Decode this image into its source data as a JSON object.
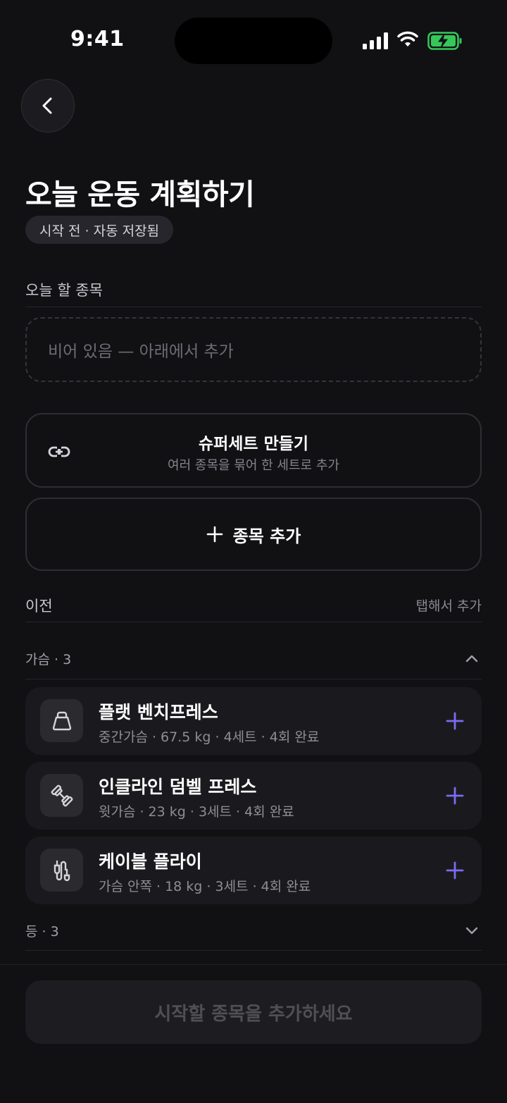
{
  "status_bar": {
    "time": "9:41"
  },
  "header": {
    "title": "오늘 운동 계획하기",
    "status_badge": "시작 전 · 자동 저장됨"
  },
  "today": {
    "section_label": "오늘 할 종목",
    "empty_text": "비어 있음 — 아래에서 추가"
  },
  "superset": {
    "title": "슈퍼세트 만들기",
    "subtitle": "여러 종목을 묶어 한 세트로 추가"
  },
  "add_exercise": {
    "label": "종목 추가"
  },
  "previous": {
    "section_label": "이전",
    "hint": "탭해서 추가",
    "groups": [
      {
        "label": "가슴 · 3",
        "expanded": true,
        "items": [
          {
            "name": "플랫 벤치프레스",
            "meta": "중간가슴 · 67.5 kg · 4세트 · 4회 완료",
            "icon": "kettlebell-icon"
          },
          {
            "name": "인클라인 덤벨 프레스",
            "meta": "윗가슴 · 23 kg · 3세트 · 4회 완료",
            "icon": "dumbbell-icon"
          },
          {
            "name": "케이블 플라이",
            "meta": "가슴 안쪽 · 18 kg · 3세트 · 4회 완료",
            "icon": "cable-icon"
          }
        ]
      },
      {
        "label": "등 · 3",
        "expanded": false
      }
    ]
  },
  "cta": {
    "label": "시작할 종목을 추가하세요"
  },
  "colors": {
    "accent": "#7b6cf6",
    "background": "#111114",
    "card": "#1a1a1e"
  }
}
